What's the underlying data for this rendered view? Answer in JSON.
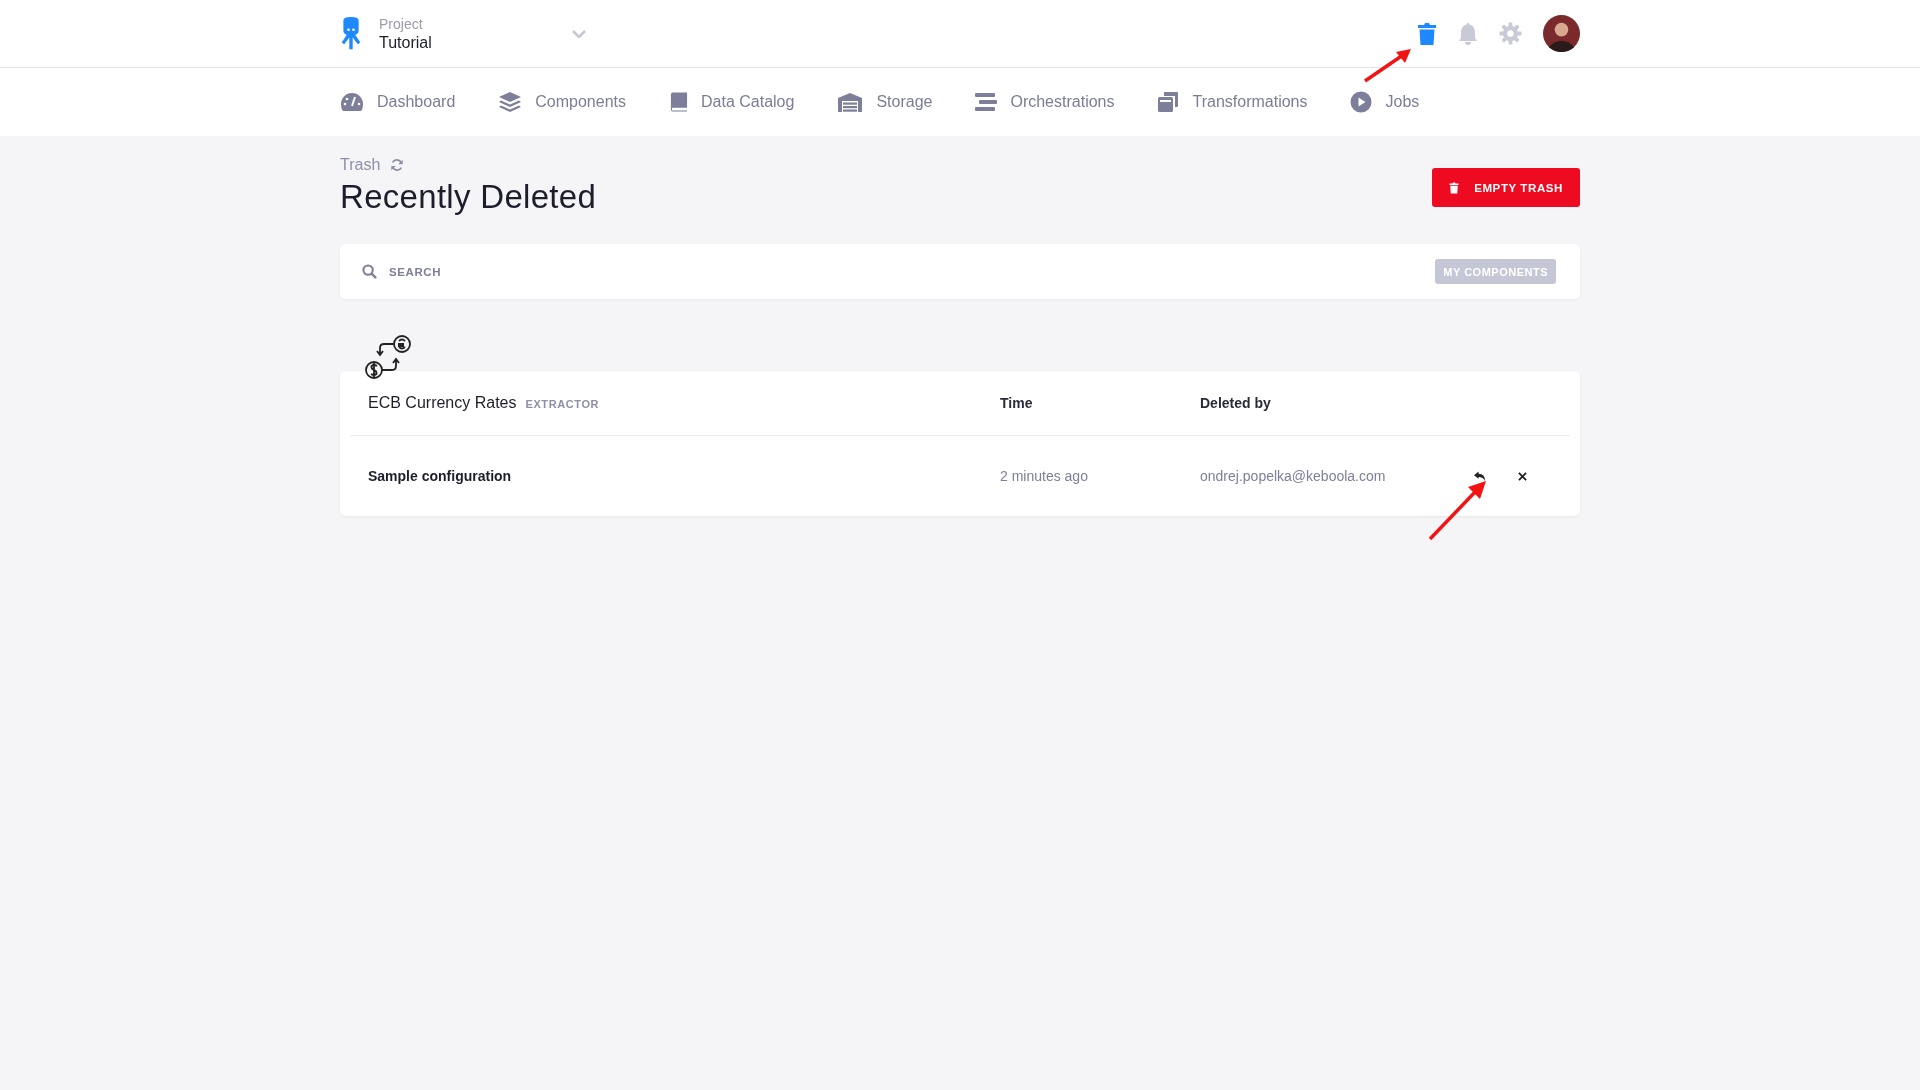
{
  "header": {
    "project_label": "Project",
    "project_name": "Tutorial"
  },
  "nav": [
    {
      "label": "Dashboard",
      "kind": "gauge"
    },
    {
      "label": "Components",
      "kind": "layers"
    },
    {
      "label": "Data Catalog",
      "kind": "book"
    },
    {
      "label": "Storage",
      "kind": "warehouse"
    },
    {
      "label": "Orchestrations",
      "kind": "bars"
    },
    {
      "label": "Transformations",
      "kind": "copies"
    },
    {
      "label": "Jobs",
      "kind": "play"
    }
  ],
  "page": {
    "breadcrumb": "Trash",
    "title": "Recently Deleted",
    "empty_button": "EMPTY TRASH"
  },
  "search": {
    "placeholder": "SEARCH",
    "filter_button": "MY COMPONENTS"
  },
  "component": {
    "name": "ECB Currency Rates",
    "type": "EXTRACTOR",
    "columns": [
      "Time",
      "Deleted by"
    ],
    "rows": [
      {
        "name": "Sample configuration",
        "time": "2 minutes ago",
        "deleted_by": "ondrej.popelka@keboola.com"
      }
    ]
  }
}
